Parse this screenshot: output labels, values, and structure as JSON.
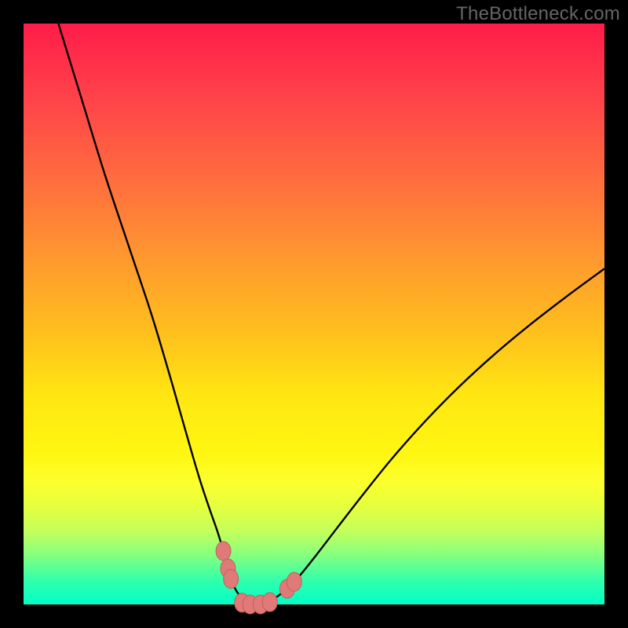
{
  "watermark": "TheBottleneck.com",
  "chart_data": {
    "type": "line",
    "title": "",
    "xlabel": "",
    "ylabel": "",
    "xlim": [
      0,
      100
    ],
    "ylim": [
      0,
      100
    ],
    "grid": false,
    "legend": false,
    "background_gradient": [
      "#ff1c49",
      "#ffe612",
      "#00ffc8"
    ],
    "series": [
      {
        "name": "left-curve",
        "x": [
          6,
          10,
          14,
          18,
          22,
          25,
          27,
          29,
          30.5,
          32,
          33.4,
          34.4,
          35.1,
          35.7,
          36.2,
          37.0,
          38.4,
          40.0
        ],
        "y": [
          100,
          87,
          74,
          62,
          50,
          40,
          33,
          26,
          21,
          16.5,
          12.5,
          9.2,
          6.6,
          4.6,
          3.2,
          1.8,
          0.6,
          0.0
        ]
      },
      {
        "name": "right-curve",
        "x": [
          40.0,
          42.0,
          44.0,
          46.7,
          50.0,
          54.0,
          58.5,
          63.5,
          69.0,
          75.0,
          81.0,
          87.5,
          94.0,
          100.0
        ],
        "y": [
          0.0,
          0.5,
          1.6,
          4.0,
          8.0,
          13.2,
          19.0,
          25.2,
          31.4,
          37.5,
          43.0,
          48.4,
          53.4,
          57.8
        ]
      }
    ],
    "markers": [
      {
        "series": "left-curve",
        "x": 34.4,
        "y": 9.2
      },
      {
        "series": "left-curve",
        "x": 35.2,
        "y": 6.2
      },
      {
        "series": "left-curve",
        "x": 35.7,
        "y": 4.4
      },
      {
        "series": "flat-bottom",
        "x": 37.6,
        "y": 0.3
      },
      {
        "series": "flat-bottom",
        "x": 39.0,
        "y": 0.0
      },
      {
        "series": "flat-bottom",
        "x": 40.8,
        "y": 0.0
      },
      {
        "series": "flat-bottom",
        "x": 42.4,
        "y": 0.4
      },
      {
        "series": "right-curve",
        "x": 45.4,
        "y": 2.7
      },
      {
        "series": "right-curve",
        "x": 46.6,
        "y": 3.9
      }
    ]
  }
}
